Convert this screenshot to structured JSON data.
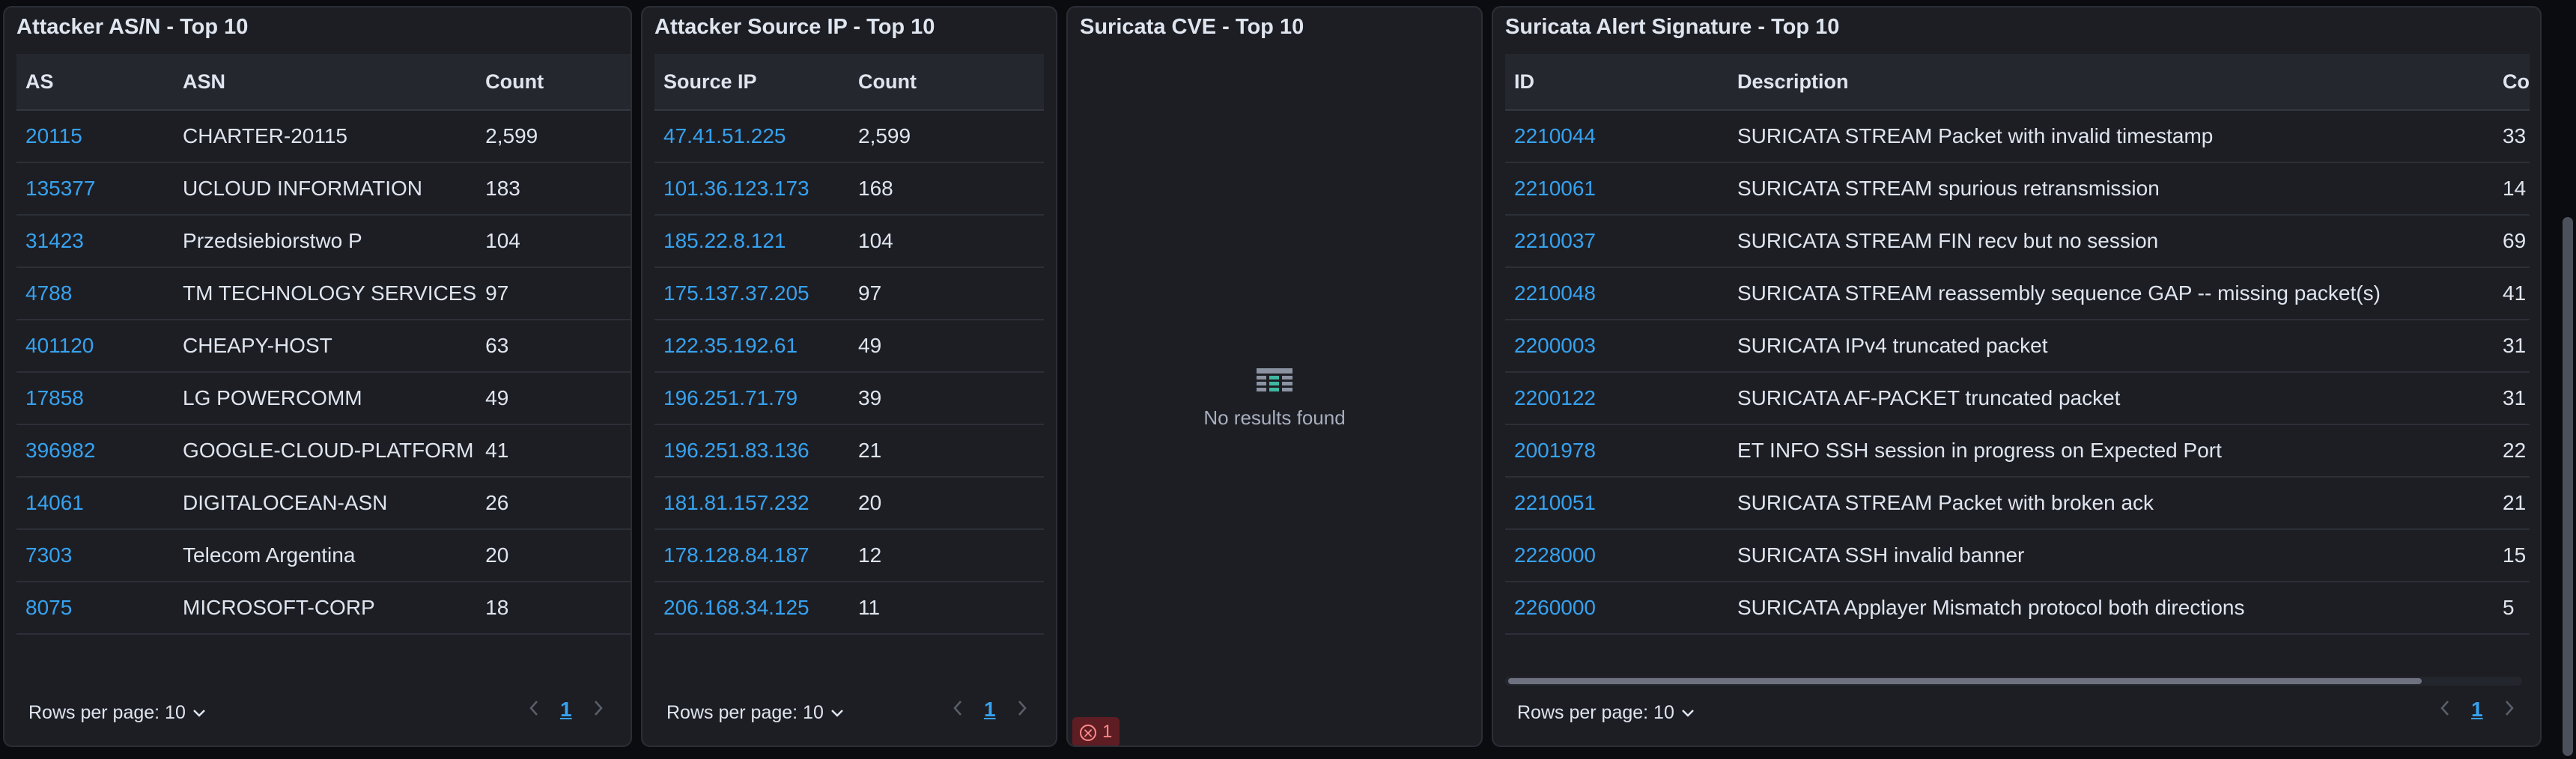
{
  "asn_panel": {
    "title": "Attacker AS/N - Top 10",
    "columns": [
      "AS",
      "ASN",
      "Count"
    ],
    "rows": [
      [
        "20115",
        "CHARTER-20115",
        "2,599"
      ],
      [
        "135377",
        "UCLOUD INFORMATION",
        "183"
      ],
      [
        "31423",
        "Przedsiebiorstwo P",
        "104"
      ],
      [
        "4788",
        "TM TECHNOLOGY SERVICES",
        "97"
      ],
      [
        "401120",
        "CHEAPY-HOST",
        "63"
      ],
      [
        "17858",
        "LG POWERCOMM",
        "49"
      ],
      [
        "396982",
        "GOOGLE-CLOUD-PLATFORM",
        "41"
      ],
      [
        "14061",
        "DIGITALOCEAN-ASN",
        "26"
      ],
      [
        "7303",
        "Telecom Argentina",
        "20"
      ],
      [
        "8075",
        "MICROSOFT-CORP",
        "18"
      ]
    ],
    "rows_per_page": "Rows per page: 10",
    "page": "1"
  },
  "ip_panel": {
    "title": "Attacker Source IP - Top 10",
    "columns": [
      "Source IP",
      "Count"
    ],
    "rows": [
      [
        "47.41.51.225",
        "2,599"
      ],
      [
        "101.36.123.173",
        "168"
      ],
      [
        "185.22.8.121",
        "104"
      ],
      [
        "175.137.37.205",
        "97"
      ],
      [
        "122.35.192.61",
        "49"
      ],
      [
        "196.251.71.79",
        "39"
      ],
      [
        "196.251.83.136",
        "21"
      ],
      [
        "181.81.157.232",
        "20"
      ],
      [
        "178.128.84.187",
        "12"
      ],
      [
        "206.168.34.125",
        "11"
      ]
    ],
    "rows_per_page": "Rows per page: 10",
    "page": "1"
  },
  "cve_panel": {
    "title": "Suricata CVE - Top 10",
    "empty_message": "No results found",
    "error_count": "1"
  },
  "sig_panel": {
    "title": "Suricata Alert Signature - Top 10",
    "columns": [
      "ID",
      "Description",
      "Co"
    ],
    "rows": [
      [
        "2210044",
        "SURICATA STREAM Packet with invalid timestamp",
        "33"
      ],
      [
        "2210061",
        "SURICATA STREAM spurious retransmission",
        "14"
      ],
      [
        "2210037",
        "SURICATA STREAM FIN recv but no session",
        "69"
      ],
      [
        "2210048",
        "SURICATA STREAM reassembly sequence GAP -- missing packet(s)",
        "41"
      ],
      [
        "2200003",
        "SURICATA IPv4 truncated packet",
        "31"
      ],
      [
        "2200122",
        "SURICATA AF-PACKET truncated packet",
        "31"
      ],
      [
        "2001978",
        "ET INFO SSH session in progress on Expected Port",
        "22"
      ],
      [
        "2210051",
        "SURICATA STREAM Packet with broken ack",
        "21"
      ],
      [
        "2228000",
        "SURICATA SSH invalid banner",
        "15"
      ],
      [
        "2260000",
        "SURICATA Applayer Mismatch protocol both directions",
        "5"
      ]
    ],
    "rows_per_page": "Rows per page: 10",
    "page": "1"
  },
  "icons": {
    "prev": "chevron-left-icon",
    "next": "chevron-right-icon",
    "dropdown": "chevron-down-icon",
    "empty": "table-empty-icon",
    "error": "error-circle-icon"
  },
  "colors": {
    "link": "#36a2ef",
    "panel_bg": "#1d1e24",
    "page_bg": "#0b0c10",
    "error_bg": "#5e1d22"
  }
}
